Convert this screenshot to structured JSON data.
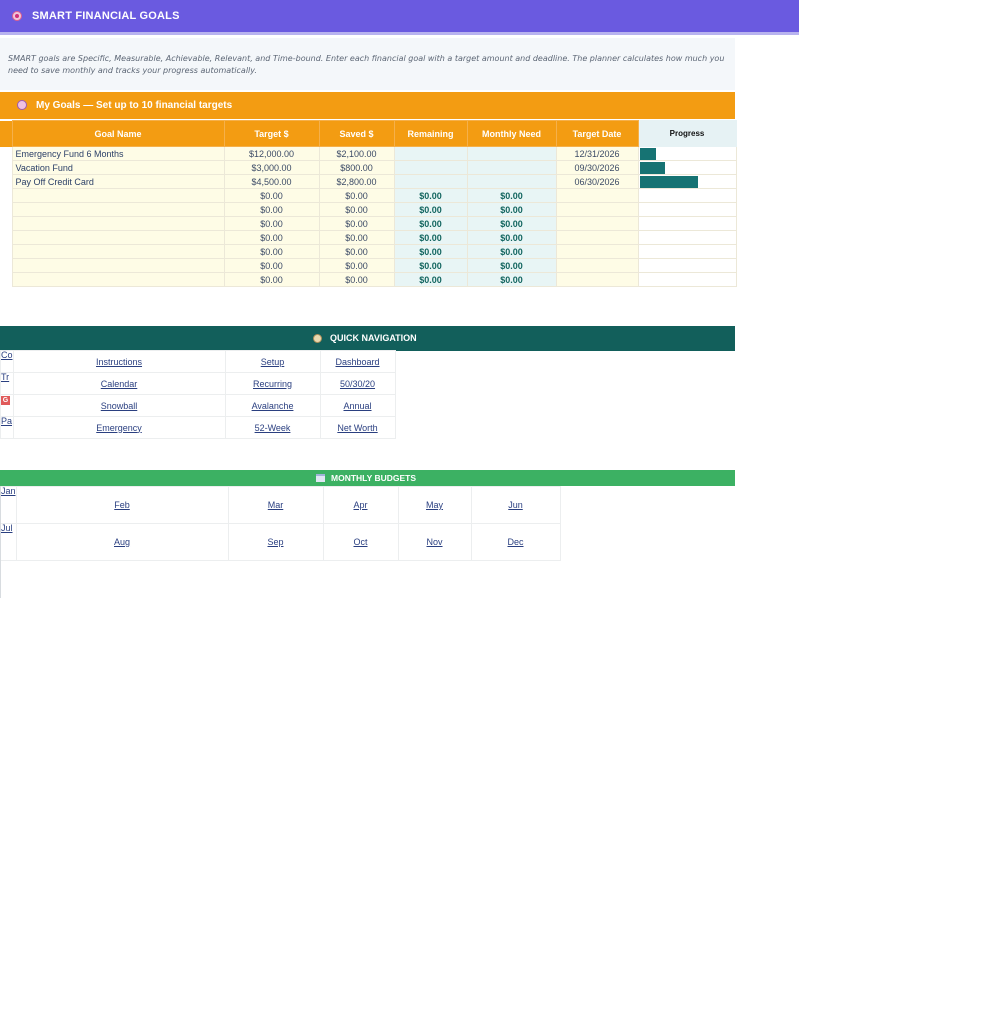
{
  "header": {
    "title": "SMART FINANCIAL GOALS",
    "icon": "target-icon",
    "bg": "#6a5ae0"
  },
  "description": "SMART goals are Specific, Measurable, Achievable, Relevant, and Time-bound. Enter each financial goal with a target amount and deadline. The planner calculates how much you need to save monthly and tracks your progress automatically.",
  "goals_section": {
    "title": "My Goals — Set up to 10 financial targets",
    "icon": "target-icon",
    "columns": [
      "Goal Name",
      "Target $",
      "Saved $",
      "Remaining",
      "Monthly Need",
      "Target Date",
      "Progress"
    ],
    "rows": [
      {
        "name": "Emergency Fund 6 Months",
        "target": "$12,000.00",
        "saved": "$2,100.00",
        "remaining": "",
        "monthly": "",
        "date": "12/31/2026",
        "progress": 0.175
      },
      {
        "name": "Vacation Fund",
        "target": "$3,000.00",
        "saved": "$800.00",
        "remaining": "",
        "monthly": "",
        "date": "09/30/2026",
        "progress": 0.267
      },
      {
        "name": "Pay Off Credit Card",
        "target": "$4,500.00",
        "saved": "$2,800.00",
        "remaining": "",
        "monthly": "",
        "date": "06/30/2026",
        "progress": 0.622
      },
      {
        "name": "",
        "target": "$0.00",
        "saved": "$0.00",
        "remaining": "$0.00",
        "monthly": "$0.00",
        "date": "",
        "progress": 0
      },
      {
        "name": "",
        "target": "$0.00",
        "saved": "$0.00",
        "remaining": "$0.00",
        "monthly": "$0.00",
        "date": "",
        "progress": 0
      },
      {
        "name": "",
        "target": "$0.00",
        "saved": "$0.00",
        "remaining": "$0.00",
        "monthly": "$0.00",
        "date": "",
        "progress": 0
      },
      {
        "name": "",
        "target": "$0.00",
        "saved": "$0.00",
        "remaining": "$0.00",
        "monthly": "$0.00",
        "date": "",
        "progress": 0
      },
      {
        "name": "",
        "target": "$0.00",
        "saved": "$0.00",
        "remaining": "$0.00",
        "monthly": "$0.00",
        "date": "",
        "progress": 0
      },
      {
        "name": "",
        "target": "$0.00",
        "saved": "$0.00",
        "remaining": "$0.00",
        "monthly": "$0.00",
        "date": "",
        "progress": 0
      },
      {
        "name": "",
        "target": "$0.00",
        "saved": "$0.00",
        "remaining": "$0.00",
        "monthly": "$0.00",
        "date": "",
        "progress": 0
      }
    ]
  },
  "quick_nav": {
    "title": "QUICK NAVIGATION",
    "icon": "compass-icon",
    "rows": [
      {
        "side": "Co",
        "links": [
          "Instructions",
          "Setup",
          "Dashboard"
        ]
      },
      {
        "side": "Tr",
        "links": [
          "Calendar",
          "Recurring",
          "50/30/20"
        ]
      },
      {
        "side": "G",
        "links": [
          "Snowball",
          "Avalanche",
          "Annual"
        ]
      },
      {
        "side": "Pa",
        "links": [
          "Emergency",
          "52-Week",
          "Net Worth"
        ]
      }
    ]
  },
  "monthly_budgets": {
    "title": "MONTHLY BUDGETS",
    "icon": "calendar-icon",
    "rows": [
      {
        "side": "Jan",
        "months": [
          "Feb",
          "Mar",
          "Apr",
          "May",
          "Jun"
        ]
      },
      {
        "side": "Jul",
        "months": [
          "Aug",
          "Sep",
          "Oct",
          "Nov",
          "Dec"
        ]
      }
    ]
  },
  "colors": {
    "goals_header": "#f39c12",
    "nav_header": "#125f5b",
    "budget_header": "#3cb163",
    "progress_bar": "#167373"
  }
}
